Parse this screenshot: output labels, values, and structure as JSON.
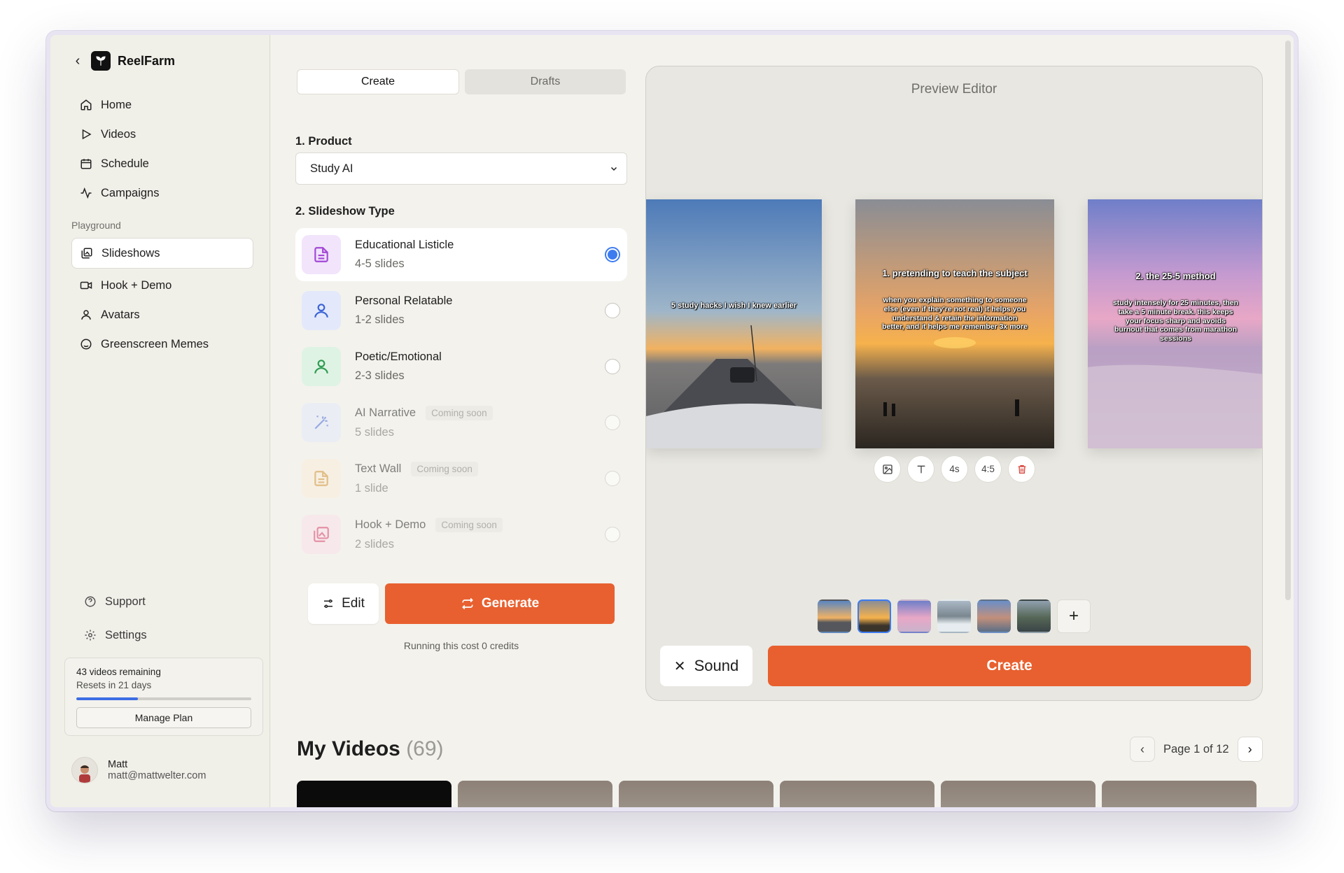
{
  "app": {
    "name": "ReelFarm"
  },
  "sidebar": {
    "nav": [
      {
        "label": "Home",
        "icon": "home-icon"
      },
      {
        "label": "Videos",
        "icon": "play-icon"
      },
      {
        "label": "Schedule",
        "icon": "calendar-icon"
      },
      {
        "label": "Campaigns",
        "icon": "activity-icon"
      }
    ],
    "section_label": "Playground",
    "playground": [
      {
        "label": "Slideshows",
        "icon": "images-icon",
        "active": true
      },
      {
        "label": "Hook + Demo",
        "icon": "video-icon"
      },
      {
        "label": "Avatars",
        "icon": "user-icon"
      },
      {
        "label": "Greenscreen Memes",
        "icon": "smiley-icon"
      }
    ],
    "bottom": [
      {
        "label": "Support",
        "icon": "help-circle-icon"
      },
      {
        "label": "Settings",
        "icon": "gear-icon"
      }
    ],
    "plan": {
      "remaining": "43 videos remaining",
      "resets": "Resets in 21 days",
      "usage_fraction": 0.35,
      "manage_label": "Manage Plan"
    },
    "user": {
      "name": "Matt",
      "email": "matt@mattwelter.com"
    }
  },
  "editor": {
    "tabs": [
      "Create",
      "Drafts"
    ],
    "product_label": "1. Product",
    "product_value": "Study AI",
    "type_label": "2. Slideshow Type",
    "types": [
      {
        "name": "Educational Listicle",
        "slides": "4-5 slides",
        "icon": "document-icon",
        "color": "#a348d6",
        "bg": "#f1e4fb",
        "selected": true
      },
      {
        "name": "Personal Relatable",
        "slides": "1-2 slides",
        "icon": "person-icon",
        "color": "#3b63d6",
        "bg": "#e3e9fb"
      },
      {
        "name": "Poetic/Emotional",
        "slides": "2-3 slides",
        "icon": "person-icon",
        "color": "#2d9b51",
        "bg": "#dff3e4"
      },
      {
        "name": "AI Narrative",
        "slides": "5 slides",
        "icon": "magic-wand-icon",
        "color": "#4b6fd6",
        "bg": "#e3e9fb",
        "badge": "Coming soon"
      },
      {
        "name": "Text Wall",
        "slides": "1 slide",
        "icon": "document-icon",
        "color": "#d49534",
        "bg": "#fbeeda",
        "badge": "Coming soon"
      },
      {
        "name": "Hook + Demo",
        "slides": "2 slides",
        "icon": "images-icon",
        "color": "#d8426f",
        "bg": "#fbe2ea",
        "badge": "Coming soon"
      }
    ],
    "edit_label": "Edit",
    "generate_label": "Generate",
    "cost_text": "Running this cost 0 credits"
  },
  "preview": {
    "title": "Preview Editor",
    "slides": [
      {
        "caption": "5 study hacks I wish I knew earlier"
      },
      {
        "heading": "1. pretending to teach the subject",
        "body": "when you explain something to someone else (even if they're not real) it helps you understand & retain the information better, and it helps me remember 3x more"
      },
      {
        "heading": "2. the 25-5 method",
        "body": "study intensely for 25 minutes, then take a 5 minute break. this keeps your focus sharp and avoids burnout that comes from marathon sessions"
      }
    ],
    "tools": {
      "duration": "4s",
      "ratio": "4:5"
    },
    "sound_label": "Sound",
    "create_label": "Create"
  },
  "my_videos": {
    "title": "My Videos",
    "count": "(69)",
    "page_text": "Page 1 of 12"
  },
  "colors": {
    "accent": "#e8602f",
    "selection": "#3d7bf0"
  }
}
